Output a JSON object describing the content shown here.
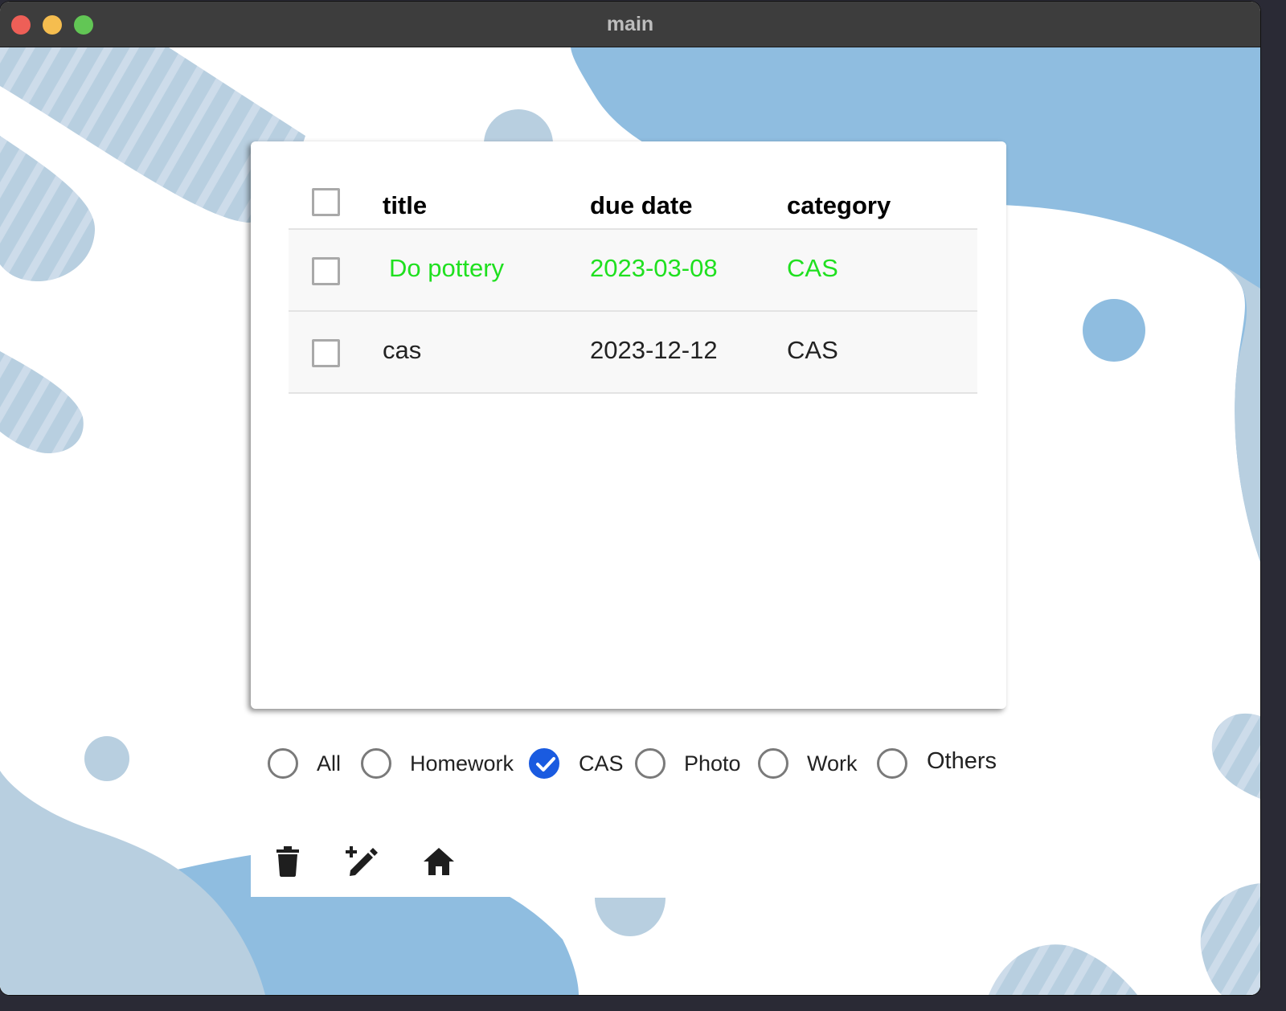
{
  "window": {
    "title": "main"
  },
  "table": {
    "headers": {
      "title": "title",
      "due_date": "due date",
      "category": "category"
    },
    "rows": [
      {
        "title": "Do pottery",
        "due_date": "2023-03-08",
        "category": "CAS",
        "completed": true,
        "text_color": "#1fe01f",
        "checked": false
      },
      {
        "title": "cas",
        "due_date": "2023-12-12",
        "category": "CAS",
        "completed": false,
        "checked": false
      }
    ]
  },
  "filters": {
    "options": [
      "All",
      "Homework",
      "CAS",
      "Photo",
      "Work",
      "Others"
    ],
    "selected": "CAS"
  },
  "toolbar": {
    "icons": [
      "trash-icon",
      "edit-add-icon",
      "home-icon"
    ]
  },
  "colors": {
    "accent": "#1a5be0",
    "background_blob": "#8fbde0",
    "background_pale": "#b8cfe0",
    "done_text": "#1fe01f"
  }
}
